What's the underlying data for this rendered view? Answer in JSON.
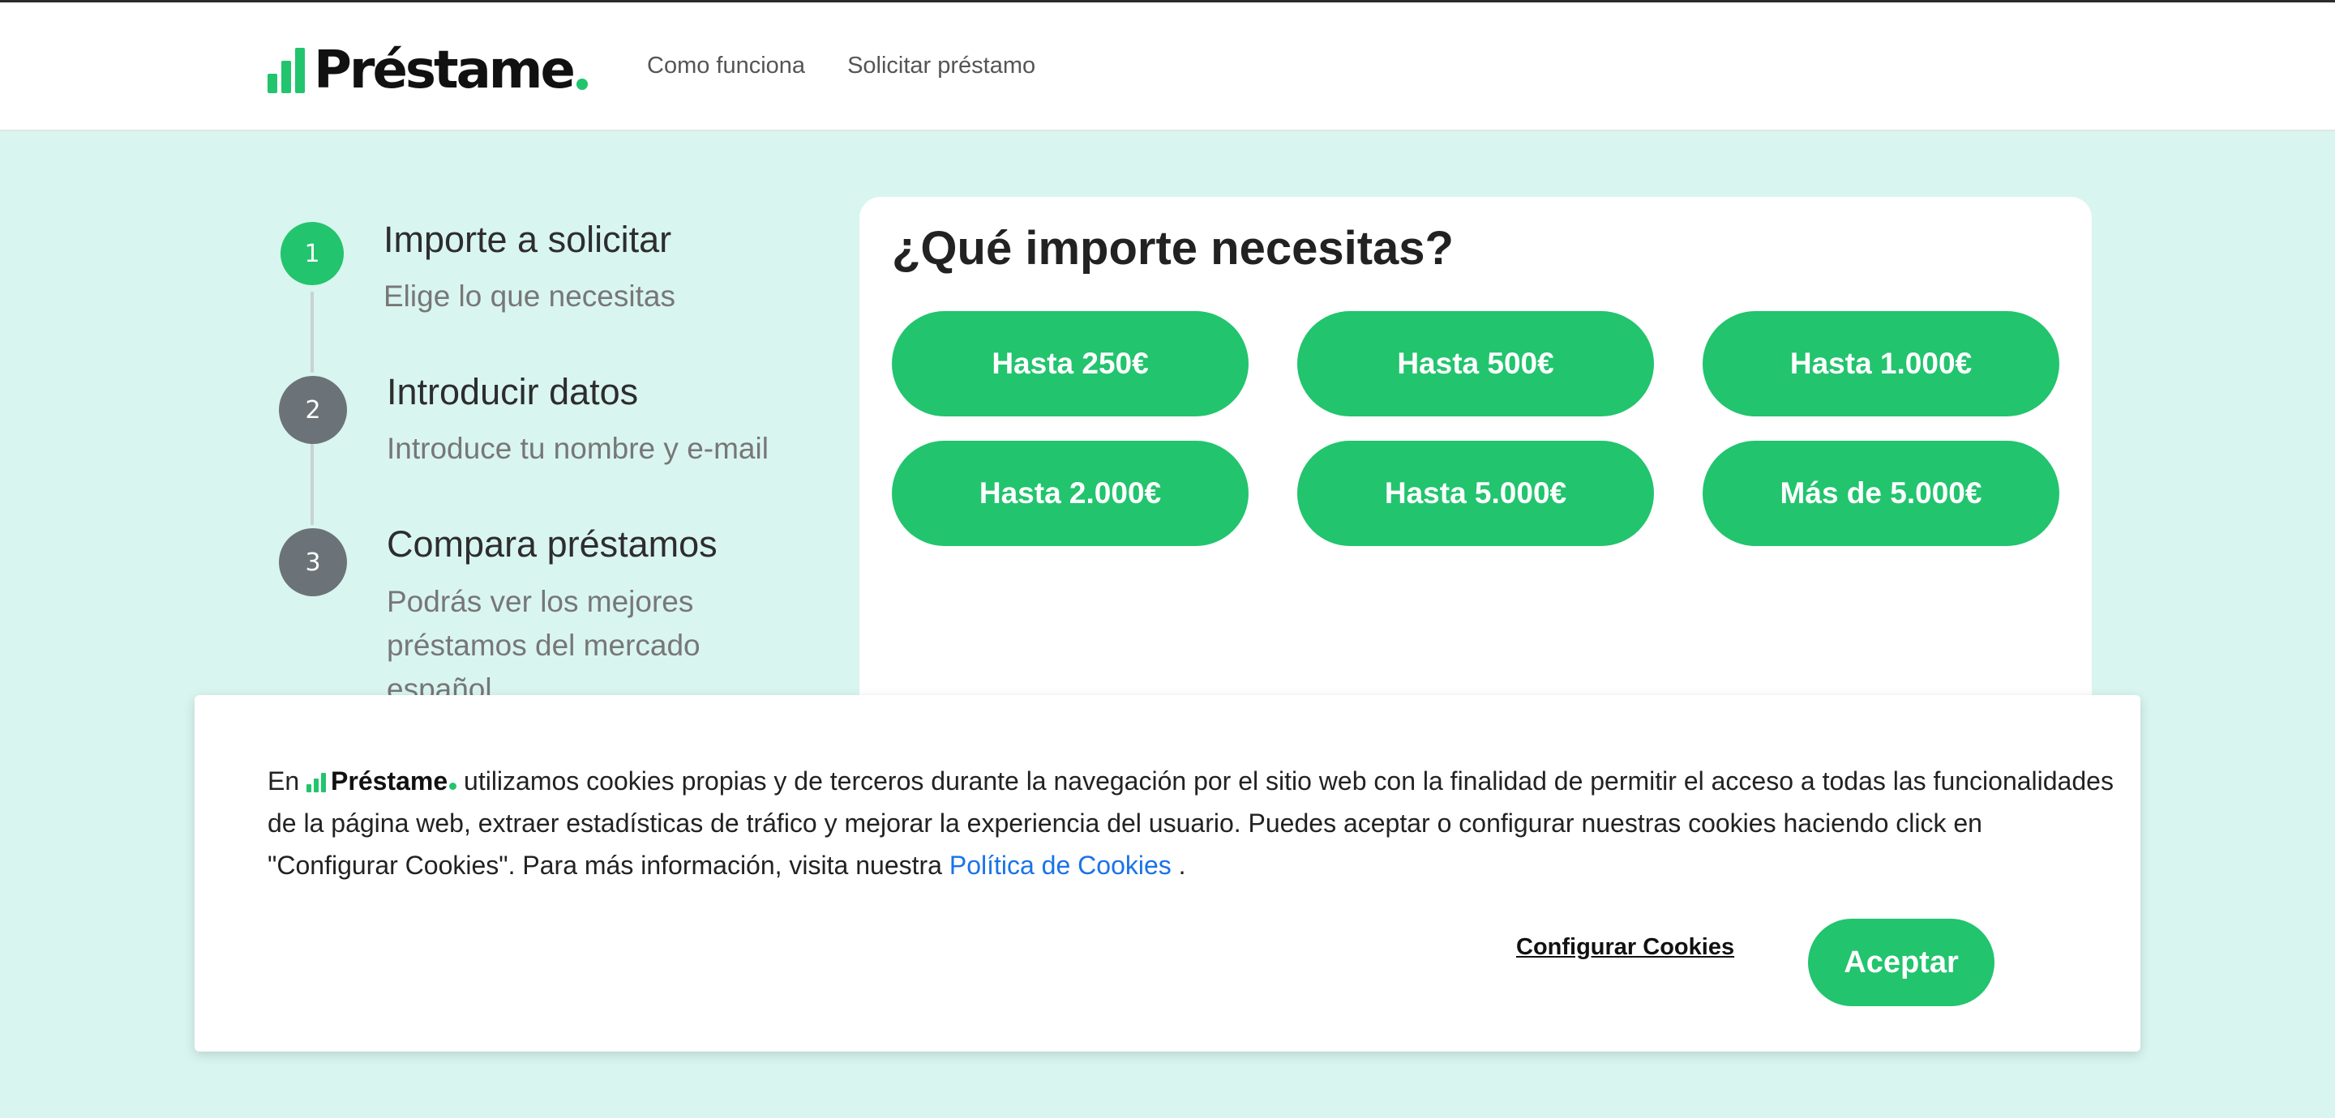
{
  "brand": {
    "name": "Préstame",
    "accent": "#22c46e"
  },
  "nav": [
    {
      "label": "Como funciona"
    },
    {
      "label": "Solicitar préstamo"
    }
  ],
  "steps": [
    {
      "number": "1",
      "title": "Importe a solicitar",
      "desc": "Elige lo que necesitas",
      "state": "active",
      "color": "#22c46e"
    },
    {
      "number": "2",
      "title": "Introducir datos",
      "desc": "Introduce tu nombre y e-mail",
      "state": "inactive",
      "color": "#6b7378"
    },
    {
      "number": "3",
      "title": "Compara préstamos",
      "desc": "Podrás ver los mejores préstamos del mercado español",
      "state": "inactive",
      "color": "#6b7378"
    }
  ],
  "amount": {
    "title": "¿Qué importe necesitas?",
    "options": [
      "Hasta 250€",
      "Hasta 500€",
      "Hasta 1.000€",
      "Hasta 2.000€",
      "Hasta 5.000€",
      "Más de 5.000€"
    ]
  },
  "cookie": {
    "prefix": "En",
    "text": "utilizamos cookies propias y de terceros durante la navegación por el sitio web con la finalidad de permitir el acceso a todas las funcionalidades de la página web, extraer estadísticas de tráfico y mejorar la experiencia del usuario. Puedes aceptar o configurar nuestras cookies haciendo click en \"Configurar Cookies\". Para más información, visita nuestra",
    "policy_link": "Política de Cookies",
    "suffix": ".",
    "configure_label": "Configurar Cookies",
    "accept_label": "Aceptar"
  }
}
